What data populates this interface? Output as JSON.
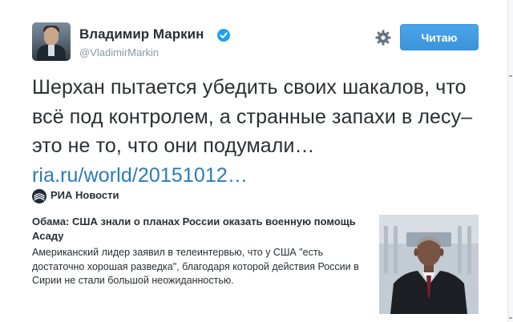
{
  "tweet": {
    "author_name": "Владимир Маркин",
    "handle": "@VladimirMarkin",
    "follow_button_label": "Читаю",
    "text": "Шерхан пытается убедить своих шакалов, что всё под контролем, а странные запахи в лесу–это не то, что они подумали… ",
    "link_text": "ria.ru/world/20151012…"
  },
  "card": {
    "source_name": "РИА Новости",
    "title": "Обама: США знали о планах России оказать военную помощь Асаду",
    "description": "Американский лидер заявил в телеинтервью, что у США \"есть достаточно хорошая разведка\", благодаря которой действия России в Сирии не стали большой неожиданностью."
  },
  "icons": {
    "verified": "verified-badge-icon",
    "settings": "gear-icon",
    "source": "ria-novosti-logo-icon"
  },
  "colors": {
    "link": "#2b7bb9",
    "follow_button": "#3b94d9",
    "verified": "#1da1f2",
    "muted_text": "#8899a6",
    "text": "#292f33"
  }
}
